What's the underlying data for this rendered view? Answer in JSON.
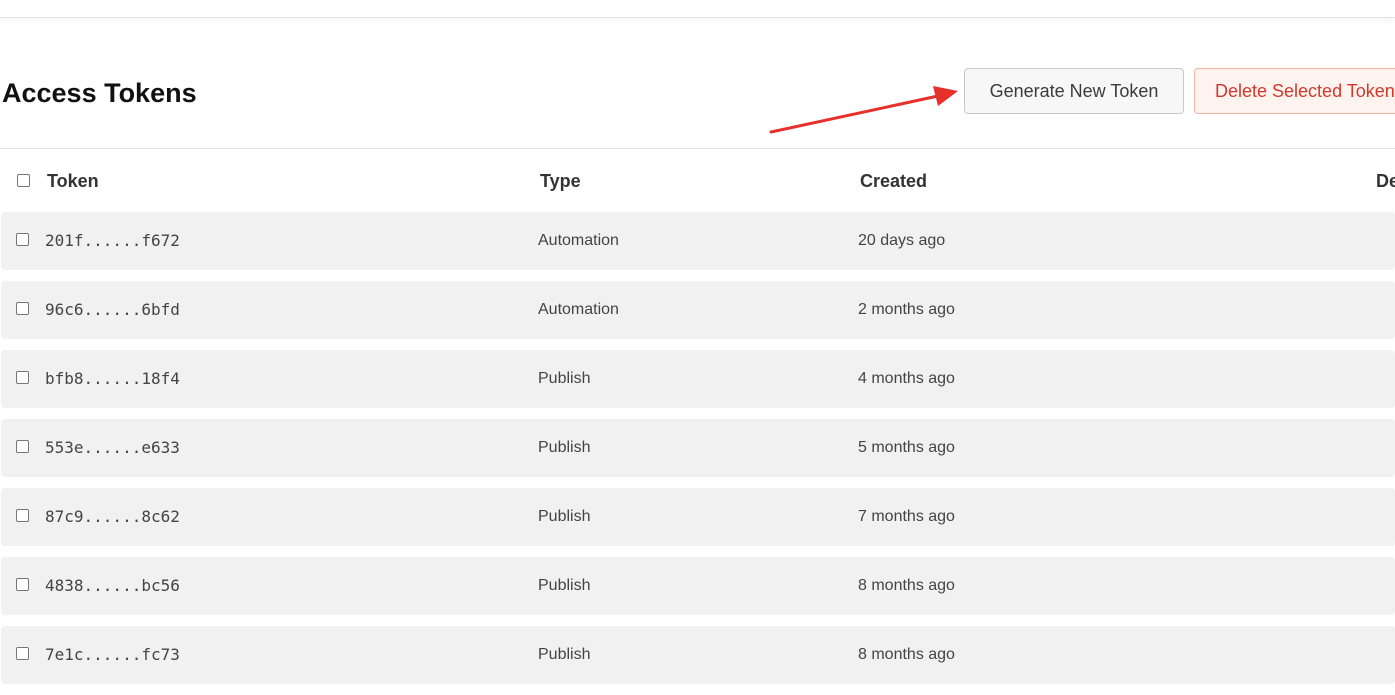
{
  "page": {
    "title": "Access Tokens"
  },
  "toolbar": {
    "generate_label": "Generate New Token",
    "delete_label": "Delete Selected Tokens"
  },
  "table": {
    "columns": [
      "Token",
      "Type",
      "Created",
      "Description"
    ],
    "rows": [
      {
        "token": "201f......f672",
        "type": "Automation",
        "created": "20 days ago"
      },
      {
        "token": "96c6......6bfd",
        "type": "Automation",
        "created": "2 months ago"
      },
      {
        "token": "bfb8......18f4",
        "type": "Publish",
        "created": "4 months ago"
      },
      {
        "token": "553e......e633",
        "type": "Publish",
        "created": "5 months ago"
      },
      {
        "token": "87c9......8c62",
        "type": "Publish",
        "created": "7 months ago"
      },
      {
        "token": "4838......bc56",
        "type": "Publish",
        "created": "8 months ago"
      },
      {
        "token": "7e1c......fc73",
        "type": "Publish",
        "created": "8 months ago"
      }
    ]
  },
  "colors": {
    "delete_accent": "#d0392b",
    "arrow": "#e8302a"
  }
}
